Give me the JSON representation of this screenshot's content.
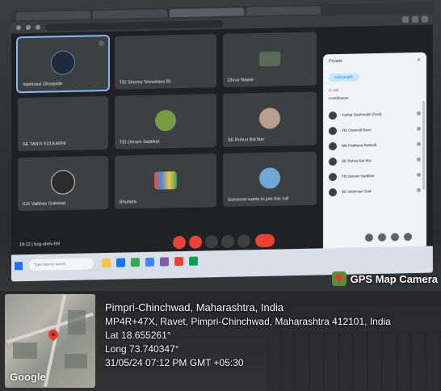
{
  "meet": {
    "tiles": [
      {
        "name": "Vaishnavi Ghorpade"
      },
      {
        "name": "TEI Shoney Srivastava B1"
      },
      {
        "name": "Dhruv Nawar"
      },
      {
        "name": "SE TANVI KULKARNI"
      },
      {
        "name": "TEI Devam Sadekar"
      },
      {
        "name": "SE Ruhua Bal Ikar"
      },
      {
        "name": "ICE Vaibhav Gaikwad"
      },
      {
        "name": "Bhuhara"
      },
      {
        "name": "Someone wants to join this call"
      }
    ],
    "sidebar": {
      "title": "People",
      "add_label": "Add people",
      "section": "In call",
      "sub": "Contributors",
      "people": [
        "Tushar Deshmukh (host)",
        "TEI Oravindi Basu",
        "ME Prathana Rathodi",
        "SE Ruhua Bal Ikar",
        "TEI Devam Sadekar",
        "SE Vaishnavi Gaik"
      ]
    },
    "meeting_info": "19:12 | bzg-ahev-hhl",
    "search_placeholder": "Type here to search"
  },
  "stamp": {
    "brand": "GPS Map Camera",
    "place": "Pimpri-Chinchwad, Maharashtra, India",
    "address": "MP4R+47X, Ravet, Pimpri-Chinchwad, Maharashtra 412101, India",
    "lat": "Lat 18.655261°",
    "long": "Long 73.740347°",
    "datetime": "31/05/24 07:12 PM GMT +05:30",
    "map_brand": "Google"
  },
  "colors": {
    "meet_bg": "#202124",
    "tile_bg": "#3c4043",
    "hangup": "#ea4335",
    "accent": "#8ab4f8"
  }
}
